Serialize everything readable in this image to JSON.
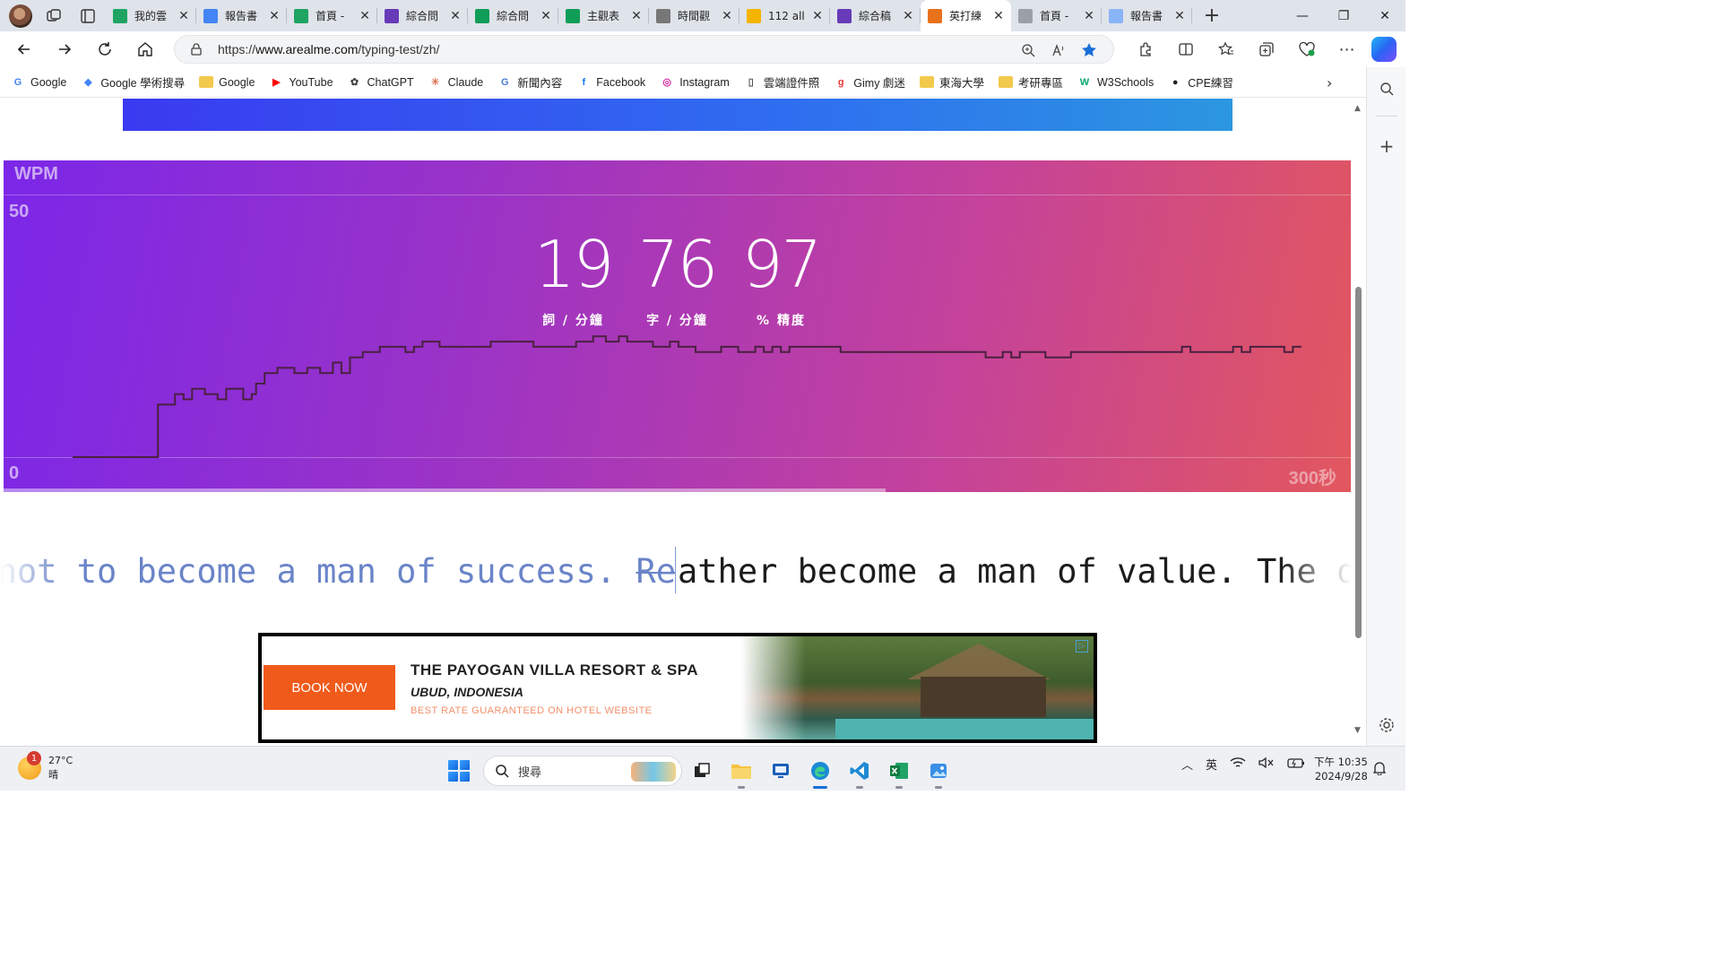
{
  "browser": {
    "tabs": [
      {
        "title": "我的雲",
        "favicon": "google-drive-icon",
        "color": "#1fa463"
      },
      {
        "title": "報告書",
        "favicon": "google-docs-icon",
        "color": "#4285f4"
      },
      {
        "title": "首頁 - ",
        "favicon": "google-drive-icon",
        "color": "#1fa463"
      },
      {
        "title": "綜合問",
        "favicon": "google-forms-icon",
        "color": "#673ab7"
      },
      {
        "title": "綜合問",
        "favicon": "google-sheets-icon",
        "color": "#0f9d58"
      },
      {
        "title": "主觀表",
        "favicon": "google-sheets-icon",
        "color": "#0f9d58"
      },
      {
        "title": "時間觀",
        "favicon": "chatgpt-icon",
        "color": "#777777"
      },
      {
        "title": "112 all",
        "favicon": "google-slides-icon",
        "color": "#f4b400"
      },
      {
        "title": "綜合稿",
        "favicon": "google-forms-icon",
        "color": "#673ab7"
      },
      {
        "title": "英打練",
        "favicon": "fox-icon",
        "color": "#e8711c",
        "active": true
      },
      {
        "title": "首頁 - ",
        "favicon": "google-drive-icon",
        "color": "#9aa0a6"
      },
      {
        "title": "報告書",
        "favicon": "google-docs-icon",
        "color": "#8ab4f8"
      }
    ],
    "url_prefix": "https://",
    "url_domain": "www.arealme.com",
    "url_path": "/typing-test/zh/"
  },
  "bookmarks": [
    {
      "label": "Google",
      "icon": "google-icon",
      "color": "#4285f4",
      "glyph": "G"
    },
    {
      "label": "Google 學術搜尋",
      "icon": "scholar-icon",
      "color": "#4285f4",
      "glyph": "◆"
    },
    {
      "label": "Google",
      "icon": "folder-icon",
      "color": "#f2c94c",
      "glyph": ""
    },
    {
      "label": "YouTube",
      "icon": "youtube-icon",
      "color": "#ff0000",
      "glyph": "▶"
    },
    {
      "label": "ChatGPT",
      "icon": "chatgpt-icon",
      "color": "#444444",
      "glyph": "✿"
    },
    {
      "label": "Claude",
      "icon": "claude-icon",
      "color": "#d97757",
      "glyph": "✳"
    },
    {
      "label": "新聞內容",
      "icon": "news-icon",
      "color": "#4a7bd8",
      "glyph": "G"
    },
    {
      "label": "Facebook",
      "icon": "facebook-icon",
      "color": "#1877f2",
      "glyph": "f"
    },
    {
      "label": "Instagram",
      "icon": "instagram-icon",
      "color": "#d6249f",
      "glyph": "◎"
    },
    {
      "label": "雲端證件照",
      "icon": "page-icon",
      "color": "#555555",
      "glyph": "▯"
    },
    {
      "label": "Gimy 劇迷",
      "icon": "gimy-icon",
      "color": "#e53935",
      "glyph": "g"
    },
    {
      "label": "東海大學",
      "icon": "folder-icon",
      "color": "#f2c94c",
      "glyph": ""
    },
    {
      "label": "考研專區",
      "icon": "folder-icon",
      "color": "#f2c94c",
      "glyph": ""
    },
    {
      "label": "W3Schools",
      "icon": "w3schools-icon",
      "color": "#04aa6d",
      "glyph": "W"
    },
    {
      "label": "CPE練習",
      "icon": "github-icon",
      "color": "#222222",
      "glyph": "●"
    }
  ],
  "typing_test": {
    "wpm_label": "WPM",
    "y_max_label": "50",
    "y_min_label": "0",
    "x_max_label": "300秒",
    "words_per_min": "19",
    "words_per_min_unit": "詞 / 分鐘",
    "chars_per_min": "76",
    "chars_per_min_unit": "字 / 分鐘",
    "accuracy": "97",
    "accuracy_unit": "% 精度",
    "time_progress_fraction": 0.655,
    "typed_text": "y not to become a man of success. ",
    "typed_wrong": "Re",
    "upcoming_text": "ather become a man of value. The onl"
  },
  "chart_data": {
    "type": "line",
    "title": "",
    "xlabel": "",
    "ylabel": "WPM",
    "xlim": [
      0,
      300
    ],
    "ylim": [
      0,
      50
    ],
    "series": [
      {
        "values_step": [
          [
            0,
            0
          ],
          [
            20,
            0
          ],
          [
            20,
            10
          ],
          [
            24,
            10
          ],
          [
            24,
            12
          ],
          [
            26,
            12
          ],
          [
            26,
            11
          ],
          [
            28,
            11
          ],
          [
            28,
            13
          ],
          [
            31,
            13
          ],
          [
            31,
            12
          ],
          [
            34,
            12
          ],
          [
            34,
            11
          ],
          [
            36,
            11
          ],
          [
            36,
            13
          ],
          [
            40,
            13
          ],
          [
            40,
            11
          ],
          [
            42,
            11
          ],
          [
            42,
            12
          ],
          [
            43,
            12
          ],
          [
            43,
            14
          ],
          [
            45,
            14
          ],
          [
            45,
            16
          ],
          [
            48,
            16
          ],
          [
            48,
            17
          ],
          [
            52,
            17
          ],
          [
            52,
            16
          ],
          [
            55,
            16
          ],
          [
            55,
            17
          ],
          [
            58,
            17
          ],
          [
            58,
            16
          ],
          [
            61,
            16
          ],
          [
            61,
            18
          ],
          [
            63,
            18
          ],
          [
            63,
            16
          ],
          [
            65,
            16
          ],
          [
            65,
            19
          ],
          [
            68,
            19
          ],
          [
            68,
            20
          ],
          [
            72,
            20
          ],
          [
            72,
            21
          ],
          [
            78,
            21
          ],
          [
            78,
            20
          ],
          [
            80,
            20
          ],
          [
            80,
            21
          ],
          [
            82,
            21
          ],
          [
            82,
            22
          ],
          [
            86,
            22
          ],
          [
            86,
            21
          ],
          [
            90,
            21
          ],
          [
            90,
            21
          ],
          [
            98,
            21
          ],
          [
            98,
            22
          ],
          [
            108,
            22
          ],
          [
            108,
            21
          ],
          [
            118,
            21
          ],
          [
            118,
            22
          ],
          [
            122,
            22
          ],
          [
            122,
            23
          ],
          [
            125,
            23
          ],
          [
            125,
            22
          ],
          [
            128,
            22
          ],
          [
            128,
            23
          ],
          [
            130,
            23
          ],
          [
            130,
            22
          ],
          [
            136,
            22
          ],
          [
            136,
            21
          ],
          [
            140,
            21
          ],
          [
            140,
            22
          ],
          [
            142,
            22
          ],
          [
            142,
            21
          ],
          [
            146,
            21
          ],
          [
            146,
            20
          ],
          [
            152,
            20
          ],
          [
            152,
            21
          ],
          [
            156,
            21
          ],
          [
            156,
            20
          ],
          [
            160,
            20
          ],
          [
            160,
            21
          ],
          [
            162,
            21
          ],
          [
            162,
            20
          ],
          [
            164,
            20
          ],
          [
            164,
            21
          ],
          [
            166,
            21
          ],
          [
            166,
            20
          ],
          [
            168,
            20
          ],
          [
            168,
            21
          ],
          [
            180,
            21
          ],
          [
            180,
            20
          ],
          [
            214,
            20
          ],
          [
            214,
            19
          ],
          [
            218,
            19
          ],
          [
            218,
            20
          ],
          [
            220,
            20
          ],
          [
            220,
            19
          ],
          [
            222,
            19
          ],
          [
            222,
            20
          ],
          [
            228,
            20
          ],
          [
            228,
            19
          ],
          [
            234,
            19
          ],
          [
            234,
            20
          ],
          [
            260,
            20
          ],
          [
            260,
            21
          ],
          [
            262,
            21
          ],
          [
            262,
            20
          ],
          [
            272,
            20
          ],
          [
            272,
            21
          ],
          [
            274,
            21
          ],
          [
            274,
            20
          ],
          [
            276,
            20
          ],
          [
            276,
            21
          ],
          [
            284,
            21
          ],
          [
            284,
            20
          ],
          [
            286,
            20
          ],
          [
            286,
            21
          ],
          [
            288,
            21
          ]
        ]
      }
    ],
    "grid": true,
    "line_color": "#4a2040"
  },
  "ad": {
    "button": "BOOK NOW",
    "headline": "THE PAYOGAN VILLA RESORT & SPA",
    "location": "UBUD, INDONESIA",
    "tagline": "BEST RATE GUARANTEED ON HOTEL WEBSITE"
  },
  "taskbar": {
    "temperature": "27°C",
    "weather": "晴",
    "weather_badge": "1",
    "search_placeholder": "搜尋",
    "ime": "英",
    "time": "下午 10:35",
    "date": "2024/9/28"
  }
}
